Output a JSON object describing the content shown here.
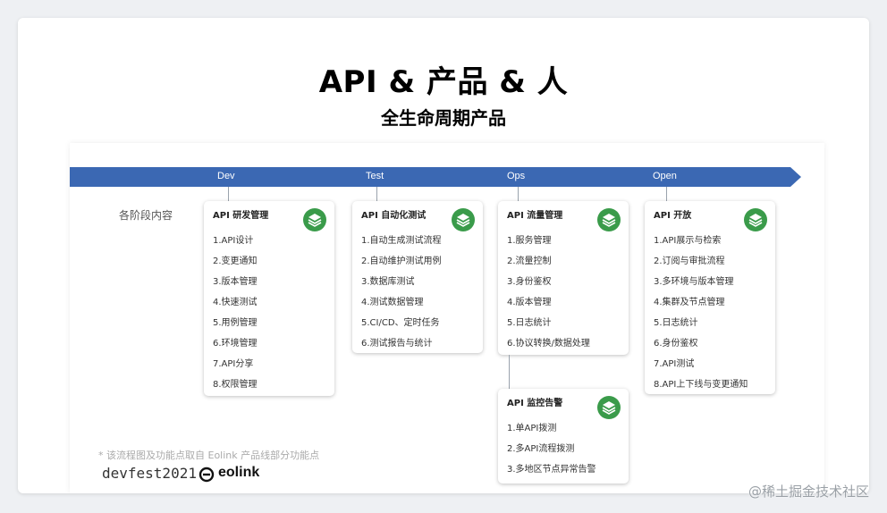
{
  "title": "API & 产品 & 人",
  "subtitle": "全生命周期产品",
  "phases": [
    "Dev",
    "Test",
    "Ops",
    "Open"
  ],
  "row_label": "各阶段内容",
  "cards": [
    {
      "title": "API 研发管理",
      "items": [
        "1.API设计",
        "2.变更通知",
        "3.版本管理",
        "4.快速测试",
        "5.用例管理",
        "6.环境管理",
        "7.API分享",
        "8.权限管理"
      ]
    },
    {
      "title": "API 自动化测试",
      "items": [
        "1.自动生成测试流程",
        "2.自动维护测试用例",
        "3.数据库测试",
        "4.测试数据管理",
        "5.CI/CD、定时任务",
        "6.测试报告与统计"
      ]
    },
    {
      "title": "API 流量管理",
      "items": [
        "1.服务管理",
        "2.流量控制",
        "3.身份鉴权",
        "4.版本管理",
        "5.日志统计",
        "6.协议转换/数据处理"
      ]
    },
    {
      "title": "API 开放",
      "items": [
        "1.API展示与检索",
        "2.订阅与审批流程",
        "3.多环境与版本管理",
        "4.集群及节点管理",
        "5.日志统计",
        "6.身份鉴权",
        "7.API测试",
        "8.API上下线与变更通知"
      ]
    },
    {
      "title": "API 监控告警",
      "items": [
        "1.单API拨测",
        "2.多API流程拨测",
        "3.多地区节点异常告警"
      ]
    }
  ],
  "footnote": "* 该流程图及功能点取自 Eolink 产品线部分功能点",
  "brand_devfest": "devfest2021",
  "brand_eolink": "eolink",
  "watermark": "@稀土掘金技术社区",
  "colors": {
    "timeline": "#3b68b3",
    "badge": "#3a9b4a"
  }
}
